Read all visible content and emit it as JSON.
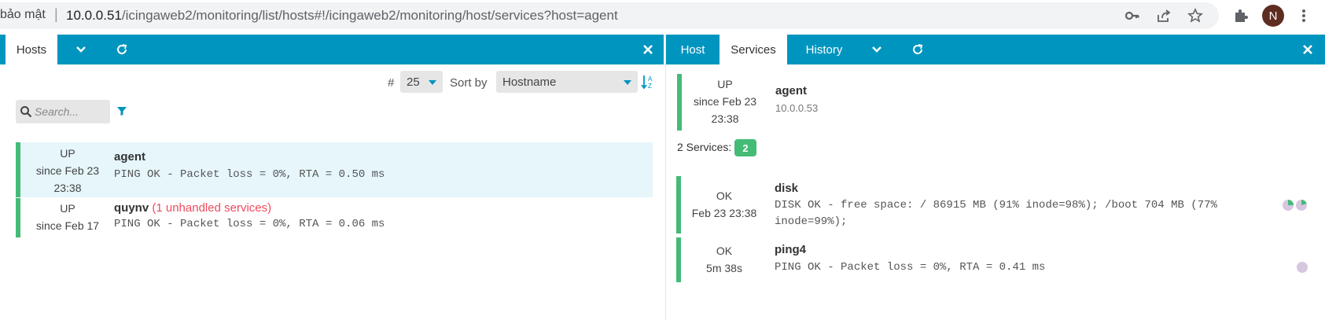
{
  "browser": {
    "security_text": "bảo mật",
    "url_host": "10.0.0.51",
    "url_path": "/icingaweb2/monitoring/list/hosts#!/icingaweb2/monitoring/host/services?host=agent",
    "avatar_letter": "N"
  },
  "left": {
    "tabs": [
      {
        "label": "Hosts"
      }
    ],
    "limit_label": "#",
    "limit_value": "25",
    "sort_label": "Sort by",
    "sort_value": "Hostname",
    "search_placeholder": "Search...",
    "hosts": [
      {
        "state": "UP",
        "since": "since Feb 23",
        "time": "23:38",
        "name": "agent",
        "note": "",
        "output": "PING OK - Packet loss = 0%, RTA = 0.50 ms"
      },
      {
        "state": "UP",
        "since": "since Feb 17",
        "time": "",
        "name": "quynv",
        "note": "(1 unhandled services)",
        "output": "PING OK - Packet loss = 0%, RTA = 0.06 ms"
      }
    ]
  },
  "right": {
    "tabs": [
      {
        "label": "Host"
      },
      {
        "label": "Services"
      },
      {
        "label": "History"
      }
    ],
    "host": {
      "state": "UP",
      "since": "since Feb 23",
      "time": "23:38",
      "name": "agent",
      "address": "10.0.0.53"
    },
    "services_label": "2 Services:",
    "services_count": "2",
    "services": [
      {
        "state": "OK",
        "since": "Feb 23 23:38",
        "name": "disk",
        "output_line1": "DISK OK - free space: / 86915 MB (91% inode=98%); /boot 704 MB (77%",
        "output_line2": "inode=99%);"
      },
      {
        "state": "OK",
        "since": "5m 38s",
        "name": "ping4",
        "output_line1": "PING OK - Packet loss = 0%, RTA = 0.41 ms",
        "output_line2": ""
      }
    ]
  },
  "colors": {
    "accent": "#0095bf",
    "ok": "#44bb77",
    "critical": "#f04a5e"
  }
}
